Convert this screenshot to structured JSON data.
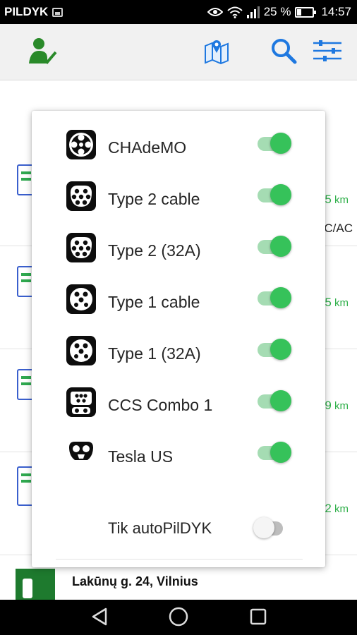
{
  "status_bar": {
    "carrier": "PILDYK",
    "battery_percent": "25 %",
    "battery_level": 0.25,
    "time": "14:57",
    "icons": [
      "gallery-notification-icon",
      "eye-icon",
      "wifi-icon",
      "signal-icon",
      "battery-charging-icon"
    ]
  },
  "toolbar": {
    "icons": [
      "user-check-icon",
      "map-icon",
      "search-icon",
      "filter-sliders-icon"
    ],
    "colors": {
      "user_icon": "#2a8a2a",
      "action_icons": "#1e78e0"
    }
  },
  "background_list": {
    "distance_unit": "km",
    "distance_fragments": [
      "5",
      "5",
      "9",
      "2"
    ],
    "row1_type_fragment": "C/AC",
    "last_item_title": "Lakūnų g. 24, Vilnius"
  },
  "filter_dialog": {
    "connectors": [
      {
        "label": "CHAdeMO",
        "enabled": true,
        "icon": "chademo-connector-icon"
      },
      {
        "label": "Type 2 cable",
        "enabled": true,
        "icon": "type2-connector-icon"
      },
      {
        "label": "Type 2 (32A)",
        "enabled": true,
        "icon": "type2-32a-connector-icon"
      },
      {
        "label": "Type 1 cable",
        "enabled": true,
        "icon": "type1-connector-icon"
      },
      {
        "label": "Type 1 (32A)",
        "enabled": true,
        "icon": "type1-32a-connector-icon"
      },
      {
        "label": "CCS Combo 1",
        "enabled": true,
        "icon": "ccs-combo1-connector-icon"
      },
      {
        "label": "Tesla US",
        "enabled": true,
        "icon": "tesla-us-connector-icon"
      }
    ],
    "auto_filter": {
      "label": "Tik autoPilDYK",
      "enabled": false
    },
    "colors": {
      "switch_on": "#36c25a",
      "switch_track_on": "#a5dcb3",
      "switch_off": "#f5f5f5"
    }
  },
  "nav_bar": {
    "icons": [
      "back-icon",
      "home-icon",
      "recents-icon"
    ]
  }
}
